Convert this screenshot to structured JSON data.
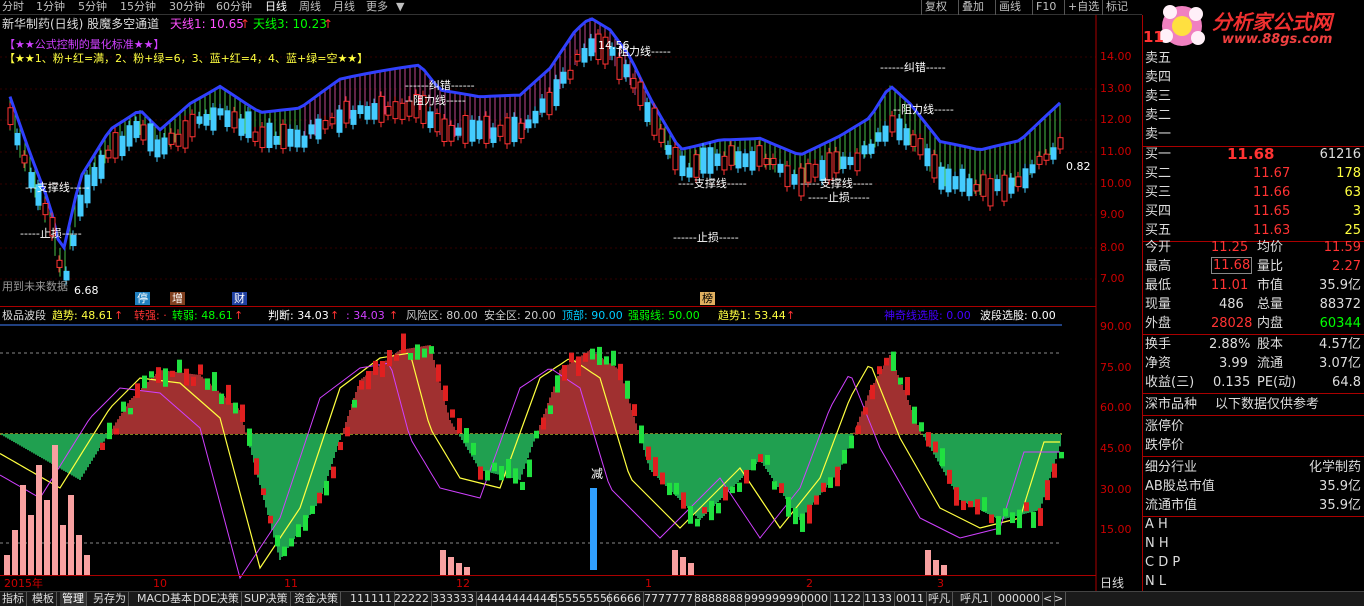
{
  "topbar": {
    "periods": [
      "分时",
      "1分钟",
      "5分钟",
      "15分钟",
      "30分钟",
      "60分钟",
      "日线",
      "周线",
      "月线",
      "更多"
    ],
    "active_period": "日线",
    "buttons": [
      "复权",
      "叠加",
      "画线",
      "F10",
      "+自选",
      "标记"
    ]
  },
  "logo": {
    "title": "分析家公式网",
    "url": "www.88gs.com"
  },
  "chart": {
    "title": "新华制药(日线) 股魔多空通道",
    "sky1_label": "天线1: 10.65",
    "sky3_label": "天线3: 10.23",
    "line2": "【★★公式控制的量化标准★★】",
    "line3": "【★★1、粉+红=满，2、粉+绿=6，3、蓝+红=4，4、蓝+绿=空★★】",
    "annotations": {
      "peak": "14.56",
      "resist1": "阻力线-----",
      "resist2": "------纠错------",
      "resist3": "--阻力线-----",
      "resist4": "------纠错-----",
      "resist5": "--阻力线-----",
      "support1": "---支撑线-----",
      "support2": "----支撑线-----",
      "support3": "-----支撑线-----",
      "stop1": "-----止损-----",
      "stop2": "------止损-----",
      "stop3": "-----止损-----",
      "low": "6.68",
      "right_val": "0.82",
      "future": "用到未来数据",
      "tags": [
        "停",
        "增",
        "财",
        "榜"
      ]
    },
    "yaxis": [
      "14.00",
      "13.00",
      "12.00",
      "11.00",
      "10.00",
      "9.00",
      "8.00",
      "7.00"
    ],
    "indicator": {
      "name": "极品波段",
      "trend": "趋势: 48.61",
      "strong": "转强: ·",
      "weak": "转弱: 48.61",
      "judge": "判断: 34.03",
      "judge2": ": 34.03",
      "risk": "风险区: 80.00",
      "safe": "安全区: 20.00",
      "top": "顶部: 90.00",
      "sw": "强弱线: 50.00",
      "trend1": "趋势1: 53.44",
      "magic": "神奇线选股: 0.00",
      "wave": "波段选股: 0.00",
      "cut": "减"
    },
    "yaxis2": [
      "90.00",
      "75.00",
      "60.00",
      "45.00",
      "30.00",
      "15.00"
    ],
    "xaxis": [
      "2015年",
      "10",
      "11",
      "12",
      "1",
      "2",
      "3"
    ]
  },
  "quote": {
    "code": "11",
    "sells": [
      {
        "label": "卖五"
      },
      {
        "label": "卖四"
      },
      {
        "label": "卖三"
      },
      {
        "label": "卖二"
      },
      {
        "label": "卖一"
      }
    ],
    "buys": [
      {
        "label": "买一",
        "price": "11.68",
        "vol": "61216"
      },
      {
        "label": "买二",
        "price": "11.67",
        "vol": "178"
      },
      {
        "label": "买三",
        "price": "11.66",
        "vol": "63"
      },
      {
        "label": "买四",
        "price": "11.65",
        "vol": "3"
      },
      {
        "label": "买五",
        "price": "11.63",
        "vol": "25"
      }
    ],
    "stats": [
      {
        "l1": "今开",
        "v1": "11.25",
        "l2": "均价",
        "v2": "11.59"
      },
      {
        "l1": "最高",
        "v1": "11.68",
        "l2": "量比",
        "v2": "2.27"
      },
      {
        "l1": "最低",
        "v1": "11.01",
        "l2": "市值",
        "v2": "35.9亿"
      },
      {
        "l1": "现量",
        "v1": "486",
        "l2": "总量",
        "v2": "88372"
      },
      {
        "l1": "外盘",
        "v1": "28028",
        "l2": "内盘",
        "v2": "60344"
      }
    ],
    "stats2": [
      {
        "l1": "换手",
        "v1": "2.88%",
        "l2": "股本",
        "v2": "4.57亿"
      },
      {
        "l1": "净资",
        "v1": "3.99",
        "l2": "流通",
        "v2": "3.07亿"
      },
      {
        "l1": "收益(三)",
        "v1": "0.135",
        "l2": "PE(动)",
        "v2": "64.8"
      }
    ],
    "market": "深市品种",
    "market_note": "以下数据仅供参考",
    "limit_up": "涨停价",
    "limit_down": "跌停价",
    "industry_label": "细分行业",
    "industry_val": "化学制药",
    "ab_label": "AB股总市值",
    "ab_val": "35.9亿",
    "float_label": "流通市值",
    "float_val": "35.9亿",
    "tabs": [
      "A H",
      "N H",
      "C D P",
      "N L"
    ]
  },
  "bottombar": {
    "tabs": [
      "指标",
      "模板",
      "管理",
      "另存为",
      "MACD基本",
      "DDE决策",
      "SUP决策",
      "资金决策",
      "111111",
      "22222",
      "333333",
      "44444444444",
      "55555555",
      "66666",
      "7777777",
      "8888888",
      "99999999",
      "0000",
      "1122",
      "1133",
      "0011",
      "呼凡",
      "呼凡1",
      "000000"
    ],
    "right": "日线"
  }
}
